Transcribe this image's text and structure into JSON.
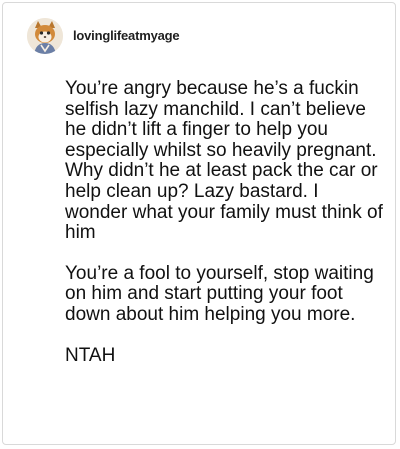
{
  "post": {
    "username": "lovinglifeatmyage",
    "avatar_icon": "cartoon-character-avatar-icon",
    "paragraphs": [
      "You’re angry because he’s a fuckin selfish lazy manchild. I can’t believe he didn’t lift a finger to help you especially whilst so heavily pregnant. Why didn’t he at least pack the car or help clean up? Lazy bastard. I wonder what your family must think of him",
      "You’re a fool to yourself, stop waiting on him and start putting your foot down about him helping you more.",
      "NTAH"
    ]
  },
  "colors": {
    "border": "#d9d9d9",
    "text": "#111111",
    "background": "#ffffff"
  }
}
